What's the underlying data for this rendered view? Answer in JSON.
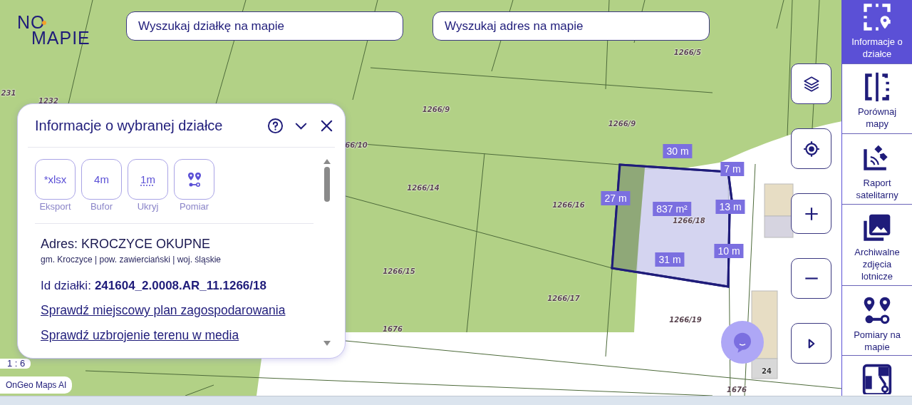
{
  "logo": {
    "line1": "NO",
    "line2": "MAPIE"
  },
  "search_fields": [
    {
      "placeholder": "Wyszukaj działkę na mapie"
    },
    {
      "placeholder": "Wyszukaj adres na mapie"
    }
  ],
  "map": {
    "parcel_labels": [
      "231",
      "1232",
      "1266/5",
      "1266/9",
      "1266/9",
      "66/10",
      "1266/14",
      "1266/16",
      "1266/18",
      "1266/15",
      "1266/17",
      "1266/19",
      "1676",
      "1676",
      "24"
    ],
    "measurements": [
      "30 m",
      "7 m",
      "27 m",
      "837 m²",
      "13 m",
      "10 m",
      "31 m"
    ],
    "scale": "1 : 6",
    "attribution": "OnGeo Maps AI"
  },
  "panel": {
    "title": "Informacje o wybranej działce",
    "tools": [
      {
        "text": "*xlsx",
        "label": "Eksport"
      },
      {
        "text": "4m",
        "label": "Bufor"
      },
      {
        "text": "1m",
        "label": "Ukryj"
      },
      {
        "label": "Pomiar"
      }
    ],
    "address": "Adres: KROCZYCE OKUPNE",
    "region": "gm. Kroczyce | pow. zawierciański | woj. śląskie",
    "parcel_id_label": "Id działki:",
    "parcel_id": "241604_2.0008.AR_11.1266/18",
    "links": [
      "Sprawdź miejscowy plan zagospodarowania",
      "Sprawdź uzbrojenie terenu w media"
    ]
  },
  "sidebar": {
    "items": [
      {
        "label": "Informacje o działce",
        "selected": true
      },
      {
        "label": "Porównaj mapy",
        "selected": false
      },
      {
        "label": "Raport satelitarny",
        "selected": false
      },
      {
        "label": "Archiwalne zdjęcia lotnicze",
        "selected": false
      },
      {
        "label": "Pomiary na mapie",
        "selected": false
      },
      {
        "selected": false
      }
    ]
  }
}
